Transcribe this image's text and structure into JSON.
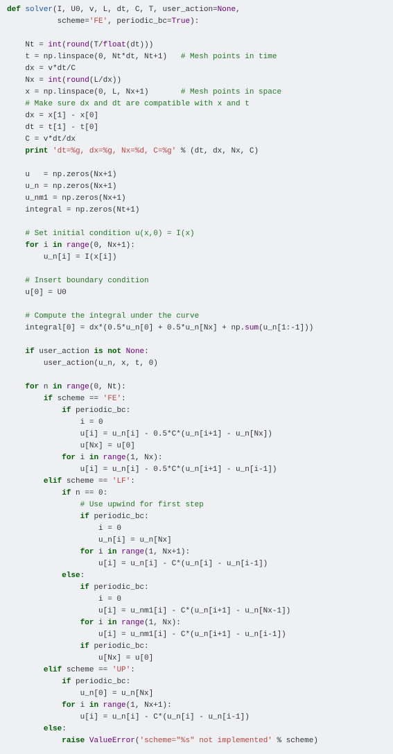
{
  "code": {
    "lines": [
      {
        "indent": 0,
        "type": "def",
        "tokens": [
          [
            "kw",
            "def"
          ],
          [
            "sp",
            " "
          ],
          [
            "fn",
            "solver"
          ],
          [
            "txt",
            "(I, U0, v, L, dt, C, T, user_action="
          ],
          [
            "bi",
            "None"
          ],
          [
            "txt",
            ","
          ]
        ]
      },
      {
        "indent": 0,
        "type": "cont",
        "tokens": [
          [
            "txt",
            "           scheme="
          ],
          [
            "str",
            "'FE'"
          ],
          [
            "txt",
            ", periodic_bc="
          ],
          [
            "bi",
            "True"
          ],
          [
            "txt",
            "):"
          ]
        ]
      },
      {
        "blank": true
      },
      {
        "indent": 1,
        "tokens": [
          [
            "txt",
            "Nt = "
          ],
          [
            "bi",
            "int"
          ],
          [
            "txt",
            "("
          ],
          [
            "bi",
            "round"
          ],
          [
            "txt",
            "(T/"
          ],
          [
            "bi",
            "float"
          ],
          [
            "txt",
            "(dt)))"
          ]
        ]
      },
      {
        "indent": 1,
        "tokens": [
          [
            "txt",
            "t = np.linspace(0, Nt*dt, Nt+1)   "
          ],
          [
            "cmt",
            "# Mesh points in time"
          ]
        ]
      },
      {
        "indent": 1,
        "tokens": [
          [
            "txt",
            "dx = v*dt/C"
          ]
        ]
      },
      {
        "indent": 1,
        "tokens": [
          [
            "txt",
            "Nx = "
          ],
          [
            "bi",
            "int"
          ],
          [
            "txt",
            "("
          ],
          [
            "bi",
            "round"
          ],
          [
            "txt",
            "(L/dx))"
          ]
        ]
      },
      {
        "indent": 1,
        "tokens": [
          [
            "txt",
            "x = np.linspace(0, L, Nx+1)       "
          ],
          [
            "cmt",
            "# Mesh points in space"
          ]
        ]
      },
      {
        "indent": 1,
        "tokens": [
          [
            "cmt",
            "# Make sure dx and dt are compatible with x and t"
          ]
        ]
      },
      {
        "indent": 1,
        "tokens": [
          [
            "txt",
            "dx = x[1] - x[0]"
          ]
        ]
      },
      {
        "indent": 1,
        "tokens": [
          [
            "txt",
            "dt = t[1] - t[0]"
          ]
        ]
      },
      {
        "indent": 1,
        "tokens": [
          [
            "txt",
            "C = v*dt/dx"
          ]
        ]
      },
      {
        "indent": 1,
        "tokens": [
          [
            "kw",
            "print"
          ],
          [
            "sp",
            " "
          ],
          [
            "str",
            "'dt=%g, dx=%g, Nx=%d, C=%g'"
          ],
          [
            "txt",
            " % (dt, dx, Nx, C)"
          ]
        ]
      },
      {
        "blank": true
      },
      {
        "indent": 1,
        "tokens": [
          [
            "txt",
            "u   = np.zeros(Nx+1)"
          ]
        ]
      },
      {
        "indent": 1,
        "tokens": [
          [
            "txt",
            "u_n = np.zeros(Nx+1)"
          ]
        ]
      },
      {
        "indent": 1,
        "tokens": [
          [
            "txt",
            "u_nm1 = np.zeros(Nx+1)"
          ]
        ]
      },
      {
        "indent": 1,
        "tokens": [
          [
            "txt",
            "integral = np.zeros(Nt+1)"
          ]
        ]
      },
      {
        "blank": true
      },
      {
        "indent": 1,
        "tokens": [
          [
            "cmt",
            "# Set initial condition u(x,0) = I(x)"
          ]
        ]
      },
      {
        "indent": 1,
        "tokens": [
          [
            "kw",
            "for"
          ],
          [
            "sp",
            " "
          ],
          [
            "txt",
            "i "
          ],
          [
            "kw",
            "in"
          ],
          [
            "sp",
            " "
          ],
          [
            "bi",
            "range"
          ],
          [
            "txt",
            "(0, Nx+1):"
          ]
        ]
      },
      {
        "indent": 2,
        "tokens": [
          [
            "txt",
            "u_n[i] = I(x[i])"
          ]
        ]
      },
      {
        "blank": true
      },
      {
        "indent": 1,
        "tokens": [
          [
            "cmt",
            "# Insert boundary condition"
          ]
        ]
      },
      {
        "indent": 1,
        "tokens": [
          [
            "txt",
            "u[0] = U0"
          ]
        ]
      },
      {
        "blank": true
      },
      {
        "indent": 1,
        "tokens": [
          [
            "cmt",
            "# Compute the integral under the curve"
          ]
        ]
      },
      {
        "indent": 1,
        "tokens": [
          [
            "txt",
            "integral[0] = dx*(0.5*u_n[0] + 0.5*u_n[Nx] + np."
          ],
          [
            "bi",
            "sum"
          ],
          [
            "txt",
            "(u_n[1:-1]))"
          ]
        ]
      },
      {
        "blank": true
      },
      {
        "indent": 1,
        "tokens": [
          [
            "kw",
            "if"
          ],
          [
            "sp",
            " "
          ],
          [
            "txt",
            "user_action "
          ],
          [
            "kw",
            "is not"
          ],
          [
            "sp",
            " "
          ],
          [
            "bi",
            "None"
          ],
          [
            "txt",
            ":"
          ]
        ]
      },
      {
        "indent": 2,
        "tokens": [
          [
            "txt",
            "user_action(u_n, x, t, 0)"
          ]
        ]
      },
      {
        "blank": true
      },
      {
        "indent": 1,
        "tokens": [
          [
            "kw",
            "for"
          ],
          [
            "sp",
            " "
          ],
          [
            "txt",
            "n "
          ],
          [
            "kw",
            "in"
          ],
          [
            "sp",
            " "
          ],
          [
            "bi",
            "range"
          ],
          [
            "txt",
            "(0, Nt):"
          ]
        ]
      },
      {
        "indent": 2,
        "tokens": [
          [
            "kw",
            "if"
          ],
          [
            "sp",
            " "
          ],
          [
            "txt",
            "scheme == "
          ],
          [
            "str",
            "'FE'"
          ],
          [
            "txt",
            ":"
          ]
        ]
      },
      {
        "indent": 3,
        "tokens": [
          [
            "kw",
            "if"
          ],
          [
            "sp",
            " "
          ],
          [
            "txt",
            "periodic_bc:"
          ]
        ]
      },
      {
        "indent": 4,
        "tokens": [
          [
            "txt",
            "i = 0"
          ]
        ]
      },
      {
        "indent": 4,
        "tokens": [
          [
            "txt",
            "u[i] = u_n[i] - 0.5*C*(u_n[i+1] - u_n[Nx])"
          ]
        ]
      },
      {
        "indent": 4,
        "tokens": [
          [
            "txt",
            "u[Nx] = u[0]"
          ]
        ]
      },
      {
        "indent": 3,
        "tokens": [
          [
            "kw",
            "for"
          ],
          [
            "sp",
            " "
          ],
          [
            "txt",
            "i "
          ],
          [
            "kw",
            "in"
          ],
          [
            "sp",
            " "
          ],
          [
            "bi",
            "range"
          ],
          [
            "txt",
            "(1, Nx):"
          ]
        ]
      },
      {
        "indent": 4,
        "tokens": [
          [
            "txt",
            "u[i] = u_n[i] - 0.5*C*(u_n[i+1] - u_n[i-1])"
          ]
        ]
      },
      {
        "indent": 2,
        "tokens": [
          [
            "kw",
            "elif"
          ],
          [
            "sp",
            " "
          ],
          [
            "txt",
            "scheme == "
          ],
          [
            "str",
            "'LF'"
          ],
          [
            "txt",
            ":"
          ]
        ]
      },
      {
        "indent": 3,
        "tokens": [
          [
            "kw",
            "if"
          ],
          [
            "sp",
            " "
          ],
          [
            "txt",
            "n == 0:"
          ]
        ]
      },
      {
        "indent": 4,
        "tokens": [
          [
            "cmt",
            "# Use upwind for first step"
          ]
        ]
      },
      {
        "indent": 4,
        "tokens": [
          [
            "kw",
            "if"
          ],
          [
            "sp",
            " "
          ],
          [
            "txt",
            "periodic_bc:"
          ]
        ]
      },
      {
        "indent": 5,
        "tokens": [
          [
            "txt",
            "i = 0"
          ]
        ]
      },
      {
        "indent": 5,
        "tokens": [
          [
            "txt",
            "u_n[i] = u_n[Nx]"
          ]
        ]
      },
      {
        "indent": 4,
        "tokens": [
          [
            "kw",
            "for"
          ],
          [
            "sp",
            " "
          ],
          [
            "txt",
            "i "
          ],
          [
            "kw",
            "in"
          ],
          [
            "sp",
            " "
          ],
          [
            "bi",
            "range"
          ],
          [
            "txt",
            "(1, Nx+1):"
          ]
        ]
      },
      {
        "indent": 5,
        "tokens": [
          [
            "txt",
            "u[i] = u_n[i] - C*(u_n[i] - u_n[i-1])"
          ]
        ]
      },
      {
        "indent": 3,
        "tokens": [
          [
            "kw",
            "else"
          ],
          [
            "txt",
            ":"
          ]
        ]
      },
      {
        "indent": 4,
        "tokens": [
          [
            "kw",
            "if"
          ],
          [
            "sp",
            " "
          ],
          [
            "txt",
            "periodic_bc:"
          ]
        ]
      },
      {
        "indent": 5,
        "tokens": [
          [
            "txt",
            "i = 0"
          ]
        ]
      },
      {
        "indent": 5,
        "tokens": [
          [
            "txt",
            "u[i] = u_nm1[i] - C*(u_n[i+1] - u_n[Nx-1])"
          ]
        ]
      },
      {
        "indent": 4,
        "tokens": [
          [
            "kw",
            "for"
          ],
          [
            "sp",
            " "
          ],
          [
            "txt",
            "i "
          ],
          [
            "kw",
            "in"
          ],
          [
            "sp",
            " "
          ],
          [
            "bi",
            "range"
          ],
          [
            "txt",
            "(1, Nx):"
          ]
        ]
      },
      {
        "indent": 5,
        "tokens": [
          [
            "txt",
            "u[i] = u_nm1[i] - C*(u_n[i+1] - u_n[i-1])"
          ]
        ]
      },
      {
        "indent": 4,
        "tokens": [
          [
            "kw",
            "if"
          ],
          [
            "sp",
            " "
          ],
          [
            "txt",
            "periodic_bc:"
          ]
        ]
      },
      {
        "indent": 5,
        "tokens": [
          [
            "txt",
            "u[Nx] = u[0]"
          ]
        ]
      },
      {
        "indent": 2,
        "tokens": [
          [
            "kw",
            "elif"
          ],
          [
            "sp",
            " "
          ],
          [
            "txt",
            "scheme == "
          ],
          [
            "str",
            "'UP'"
          ],
          [
            "txt",
            ":"
          ]
        ]
      },
      {
        "indent": 3,
        "tokens": [
          [
            "kw",
            "if"
          ],
          [
            "sp",
            " "
          ],
          [
            "txt",
            "periodic_bc:"
          ]
        ]
      },
      {
        "indent": 4,
        "tokens": [
          [
            "txt",
            "u_n[0] = u_n[Nx]"
          ]
        ]
      },
      {
        "indent": 3,
        "tokens": [
          [
            "kw",
            "for"
          ],
          [
            "sp",
            " "
          ],
          [
            "txt",
            "i "
          ],
          [
            "kw",
            "in"
          ],
          [
            "sp",
            " "
          ],
          [
            "bi",
            "range"
          ],
          [
            "txt",
            "(1, Nx+1):"
          ]
        ]
      },
      {
        "indent": 4,
        "tokens": [
          [
            "txt",
            "u[i] = u_n[i] - C*(u_n[i] - u_n[i-1])"
          ]
        ]
      },
      {
        "indent": 2,
        "tokens": [
          [
            "kw",
            "else"
          ],
          [
            "txt",
            ":"
          ]
        ]
      },
      {
        "indent": 3,
        "tokens": [
          [
            "kw",
            "raise"
          ],
          [
            "sp",
            " "
          ],
          [
            "bi",
            "ValueError"
          ],
          [
            "txt",
            "("
          ],
          [
            "str",
            "'scheme=\"%s\" not implemented'"
          ],
          [
            "txt",
            " % scheme)"
          ]
        ]
      }
    ]
  },
  "indentUnit": "    "
}
